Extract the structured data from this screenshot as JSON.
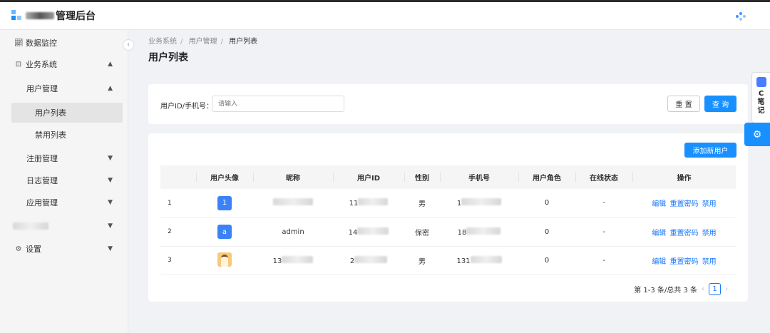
{
  "header": {
    "title_suffix": "管理后台"
  },
  "sidebar": {
    "items": [
      {
        "label": "数据监控",
        "icon": "chart-icon"
      },
      {
        "label": "业务系统",
        "icon": "lock-icon",
        "chevron": "⌃"
      },
      {
        "label": "用户管理",
        "chevron": "⌃"
      },
      {
        "label": "用户列表"
      },
      {
        "label": "禁用列表"
      },
      {
        "label": "注册管理",
        "chevron": "⌄"
      },
      {
        "label": "日志管理",
        "chevron": "⌄"
      },
      {
        "label": "应用管理",
        "chevron": "⌄"
      },
      {
        "label": "",
        "chevron": "⌄"
      },
      {
        "label": "设置",
        "icon": "gear-icon",
        "chevron": "⌄"
      }
    ]
  },
  "breadcrumb": [
    "业务系统",
    "用户管理",
    "用户列表"
  ],
  "page_title": "用户列表",
  "filter": {
    "label": "用户ID/手机号：",
    "placeholder": "请输入",
    "reset": "重 置",
    "search": "查 询"
  },
  "table": {
    "add_button": "添加新用户",
    "columns": [
      "",
      "用户头像",
      "昵称",
      "用户ID",
      "性别",
      "手机号",
      "用户角色",
      "在线状态",
      "操作"
    ],
    "rows": [
      {
        "index": "1",
        "avatar": "1",
        "nickname": "",
        "id": "11",
        "gender": "男",
        "phone": "1",
        "role": "0",
        "status": "-"
      },
      {
        "index": "2",
        "avatar": "a",
        "nickname": "admin",
        "id": "14",
        "gender": "保密",
        "phone": "18",
        "role": "0",
        "status": "-"
      },
      {
        "index": "3",
        "avatar": "",
        "nickname": "13",
        "id": "2",
        "gender": "男",
        "phone": "131",
        "role": "0",
        "status": "-"
      }
    ],
    "actions": [
      "编辑",
      "重置密码",
      "禁用"
    ]
  },
  "pagination": {
    "summary": "第 1-3 条/总共 3 条",
    "current": "1"
  },
  "float": {
    "note_letter": "C",
    "note_text1": "笔",
    "note_text2": "记"
  },
  "colors": {
    "primary": "#1890ff"
  }
}
